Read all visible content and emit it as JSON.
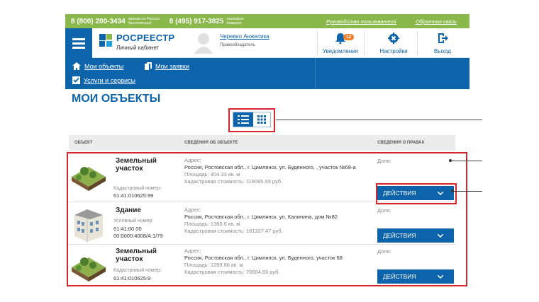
{
  "topbar": {
    "phone1": "8 (800) 200-3434",
    "phone1_note": "звонок по России бесплатный",
    "phone2": "8 (495) 917-3825",
    "phone2_note": "телефон доверия",
    "guide_link": "Руководство пользователя",
    "feedback_link": "Обратная связь"
  },
  "header": {
    "brand": "РОСРЕЕСТР",
    "brand_sub": "Личный кабинет",
    "user_name": "Черевко Анжелика",
    "user_role": "Правообладатель",
    "notifications_label": "Уведомления",
    "notifications_count": "12",
    "settings_label": "Настройки",
    "logout_label": "Выход"
  },
  "nav": {
    "my_objects": "Мои объекты",
    "my_requests": "Мои заявки",
    "services": "Услуги и сервисы"
  },
  "page": {
    "title": "МОИ ОБЪЕКТЫ"
  },
  "table": {
    "col_object": "ОБЪЕКТ",
    "col_info": "СВЕДЕНИЯ ОБ ОБЪЕКТЕ",
    "col_rights": "СВЕДЕНИЯ О ПРАВАХ",
    "rows": [
      {
        "type": "Земельный участок",
        "num_label": "Кадастровый номер:",
        "num_value": "61:41:010625:99",
        "num_value2": "",
        "address_label": "Адрес:",
        "address": "Россия, Ростовская обл., г. Цимлянск, ул. Буденного, , участок №68-а",
        "area": "Площадь: 404.33 кв. м",
        "cost": "Кадастровая стоимость: 119095.59 руб.",
        "share": "Доля:",
        "action": "ДЕЙСТВИЯ"
      },
      {
        "type": "Здание",
        "num_label": "Условный номер:",
        "num_value": "61:41:00 00",
        "num_value2": "00:0000:4008/A:1/79",
        "address_label": "Адрес:",
        "address": "Россия, Ростовская обл., г. Цимлянск, ул. Калинина, дом №82",
        "area": "Площадь: 1386.6 кв. м",
        "cost": "Кадастровая стоимость: 161327.47 руб.",
        "share": "Доля:",
        "action": "ДЕЙСТВИЯ"
      },
      {
        "type": "Земельный участок",
        "num_label": "Кадастровый номер:",
        "num_value": "61:41:010625:9",
        "num_value2": "",
        "address_label": "Адрес:",
        "address": "Россия, Ростовская обл., г. Цимлянск, ул. Буденного, участок 68",
        "area": "Площадь: 1289.86 кв. м",
        "cost": "Кадастровая стоимость: 70504.69 руб.",
        "share": "Доля:",
        "action": "ДЕЙСТВИЯ"
      }
    ]
  },
  "colors": {
    "brand_blue": "#0e64ab",
    "top_green": "#8ab84a",
    "highlight_red": "#d7262f",
    "badge_orange": "#f0812d"
  },
  "icons": [
    "menu-icon",
    "rosreestr-logo-icon",
    "user-avatar-icon",
    "bell-icon",
    "gear-icon",
    "logout-icon",
    "home-icon",
    "document-icon",
    "checkbox-icon",
    "list-view-icon",
    "grid-view-icon",
    "chevron-down-icon"
  ]
}
